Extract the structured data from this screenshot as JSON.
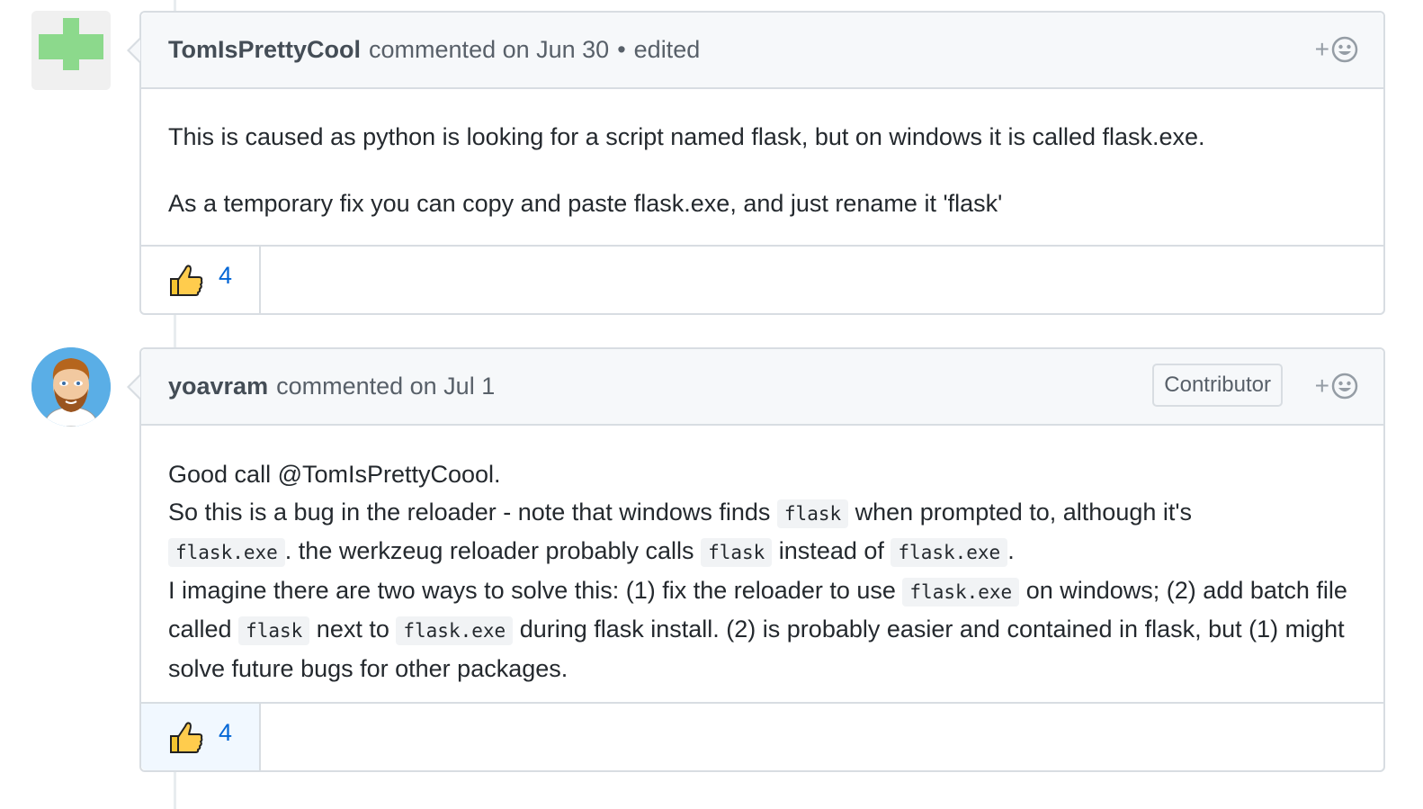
{
  "comments": [
    {
      "author": "TomIsPrettyCool",
      "action": "commented on Jun 30",
      "separator": "•",
      "edited": "edited",
      "avatar_icon": "identicon-avatar",
      "body": {
        "p1": "This is caused as python is looking for a script named flask, but on windows it is called flask.exe.",
        "p2": "As a temporary fix you can copy and paste flask.exe, and just rename it 'flask'"
      },
      "reaction": {
        "emoji": "thumbs-up-icon",
        "count": "4"
      },
      "add_reaction_plus": "+"
    },
    {
      "author": "yoavram",
      "action": "commented on Jul 1",
      "badge": "Contributor",
      "avatar_icon": "user-avatar",
      "body": {
        "l1": "Good call @TomIsPrettyCoool.",
        "l2_a": "So this is a bug in the reloader - note that windows finds",
        "l2_code1": "flask",
        "l2_b": "when prompted to, although it's",
        "l3_code1": "flask.exe",
        "l3_a": ". the werkzeug reloader probably calls",
        "l3_code2": "flask",
        "l3_b": "instead of",
        "l3_code3": "flask.exe",
        "l3_c": ".",
        "l4_a": "I imagine there are two ways to solve this: (1) fix the reloader to use",
        "l4_code1": "flask.exe",
        "l4_b": "on windows; (2) add batch file called",
        "l4_code2": "flask",
        "l4_c": "next to",
        "l4_code3": "flask.exe",
        "l4_d": "during flask install. (2) is probably easier and contained in flask, but (1) might solve future bugs for other packages."
      },
      "reaction": {
        "emoji": "thumbs-up-icon",
        "count": "4"
      },
      "add_reaction_plus": "+"
    }
  ],
  "colors": {
    "link_blue": "#0366d6",
    "header_bg": "#f6f8fa",
    "border": "#d8dde2",
    "identicon_green": "#8cd98c",
    "reaction_active_bg": "#f1f8ff"
  }
}
